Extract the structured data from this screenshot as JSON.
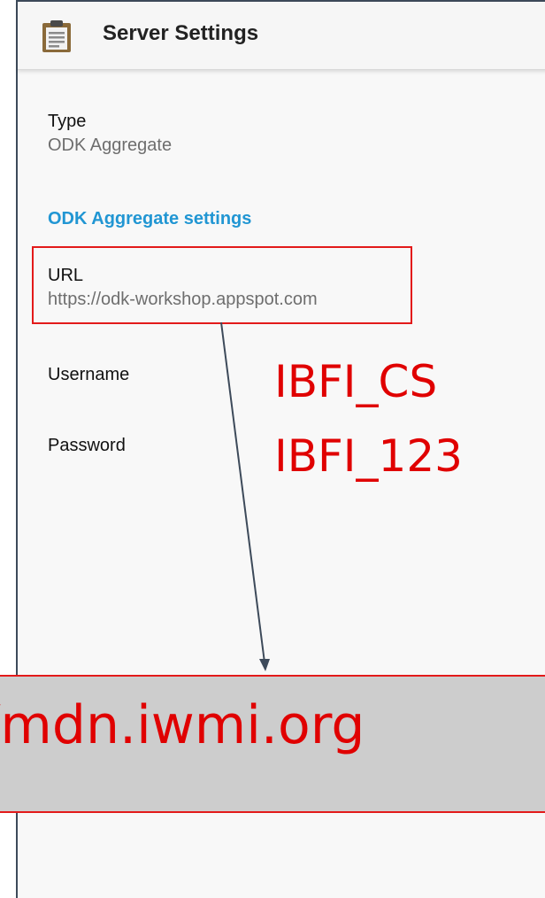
{
  "appbar": {
    "title": "Server Settings",
    "icon": "clipboard-icon"
  },
  "prefs": {
    "type": {
      "title": "Type",
      "summary": "ODK Aggregate"
    },
    "category": "ODK Aggregate settings",
    "url": {
      "title": "URL",
      "summary": "https://odk-workshop.appspot.com"
    },
    "username": {
      "title": "Username"
    },
    "password": {
      "title": "Password"
    }
  },
  "annotations": {
    "username_value": "IBFI_CS",
    "password_value": "IBFI_123",
    "url_replacement": "//mdn.iwmi.org"
  },
  "colors": {
    "accent": "#2196d3",
    "annotation": "#e00000",
    "banner_bg": "#cdcdcd"
  }
}
